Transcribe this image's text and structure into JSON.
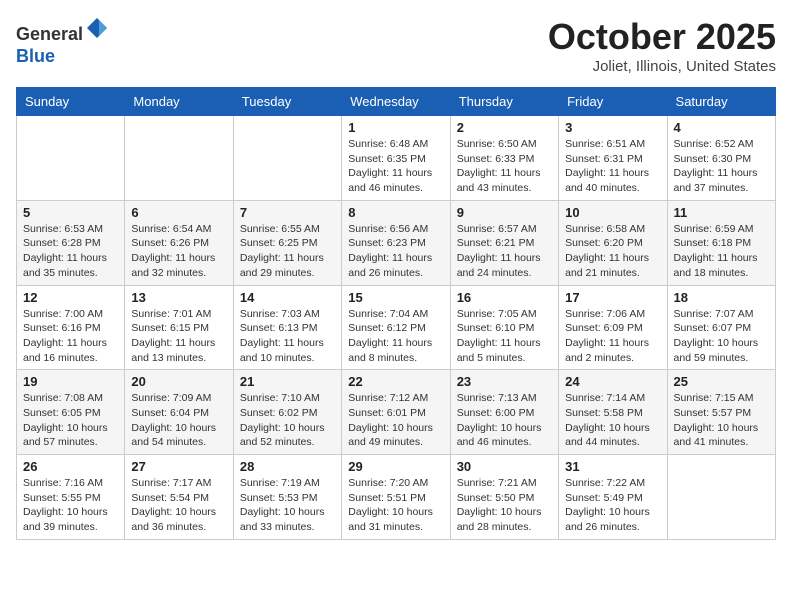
{
  "header": {
    "logo_line1": "General",
    "logo_line2": "Blue",
    "month": "October 2025",
    "location": "Joliet, Illinois, United States"
  },
  "days_of_week": [
    "Sunday",
    "Monday",
    "Tuesday",
    "Wednesday",
    "Thursday",
    "Friday",
    "Saturday"
  ],
  "weeks": [
    [
      {
        "day": "",
        "info": ""
      },
      {
        "day": "",
        "info": ""
      },
      {
        "day": "",
        "info": ""
      },
      {
        "day": "1",
        "info": "Sunrise: 6:48 AM\nSunset: 6:35 PM\nDaylight: 11 hours\nand 46 minutes."
      },
      {
        "day": "2",
        "info": "Sunrise: 6:50 AM\nSunset: 6:33 PM\nDaylight: 11 hours\nand 43 minutes."
      },
      {
        "day": "3",
        "info": "Sunrise: 6:51 AM\nSunset: 6:31 PM\nDaylight: 11 hours\nand 40 minutes."
      },
      {
        "day": "4",
        "info": "Sunrise: 6:52 AM\nSunset: 6:30 PM\nDaylight: 11 hours\nand 37 minutes."
      }
    ],
    [
      {
        "day": "5",
        "info": "Sunrise: 6:53 AM\nSunset: 6:28 PM\nDaylight: 11 hours\nand 35 minutes."
      },
      {
        "day": "6",
        "info": "Sunrise: 6:54 AM\nSunset: 6:26 PM\nDaylight: 11 hours\nand 32 minutes."
      },
      {
        "day": "7",
        "info": "Sunrise: 6:55 AM\nSunset: 6:25 PM\nDaylight: 11 hours\nand 29 minutes."
      },
      {
        "day": "8",
        "info": "Sunrise: 6:56 AM\nSunset: 6:23 PM\nDaylight: 11 hours\nand 26 minutes."
      },
      {
        "day": "9",
        "info": "Sunrise: 6:57 AM\nSunset: 6:21 PM\nDaylight: 11 hours\nand 24 minutes."
      },
      {
        "day": "10",
        "info": "Sunrise: 6:58 AM\nSunset: 6:20 PM\nDaylight: 11 hours\nand 21 minutes."
      },
      {
        "day": "11",
        "info": "Sunrise: 6:59 AM\nSunset: 6:18 PM\nDaylight: 11 hours\nand 18 minutes."
      }
    ],
    [
      {
        "day": "12",
        "info": "Sunrise: 7:00 AM\nSunset: 6:16 PM\nDaylight: 11 hours\nand 16 minutes."
      },
      {
        "day": "13",
        "info": "Sunrise: 7:01 AM\nSunset: 6:15 PM\nDaylight: 11 hours\nand 13 minutes."
      },
      {
        "day": "14",
        "info": "Sunrise: 7:03 AM\nSunset: 6:13 PM\nDaylight: 11 hours\nand 10 minutes."
      },
      {
        "day": "15",
        "info": "Sunrise: 7:04 AM\nSunset: 6:12 PM\nDaylight: 11 hours\nand 8 minutes."
      },
      {
        "day": "16",
        "info": "Sunrise: 7:05 AM\nSunset: 6:10 PM\nDaylight: 11 hours\nand 5 minutes."
      },
      {
        "day": "17",
        "info": "Sunrise: 7:06 AM\nSunset: 6:09 PM\nDaylight: 11 hours\nand 2 minutes."
      },
      {
        "day": "18",
        "info": "Sunrise: 7:07 AM\nSunset: 6:07 PM\nDaylight: 10 hours\nand 59 minutes."
      }
    ],
    [
      {
        "day": "19",
        "info": "Sunrise: 7:08 AM\nSunset: 6:05 PM\nDaylight: 10 hours\nand 57 minutes."
      },
      {
        "day": "20",
        "info": "Sunrise: 7:09 AM\nSunset: 6:04 PM\nDaylight: 10 hours\nand 54 minutes."
      },
      {
        "day": "21",
        "info": "Sunrise: 7:10 AM\nSunset: 6:02 PM\nDaylight: 10 hours\nand 52 minutes."
      },
      {
        "day": "22",
        "info": "Sunrise: 7:12 AM\nSunset: 6:01 PM\nDaylight: 10 hours\nand 49 minutes."
      },
      {
        "day": "23",
        "info": "Sunrise: 7:13 AM\nSunset: 6:00 PM\nDaylight: 10 hours\nand 46 minutes."
      },
      {
        "day": "24",
        "info": "Sunrise: 7:14 AM\nSunset: 5:58 PM\nDaylight: 10 hours\nand 44 minutes."
      },
      {
        "day": "25",
        "info": "Sunrise: 7:15 AM\nSunset: 5:57 PM\nDaylight: 10 hours\nand 41 minutes."
      }
    ],
    [
      {
        "day": "26",
        "info": "Sunrise: 7:16 AM\nSunset: 5:55 PM\nDaylight: 10 hours\nand 39 minutes."
      },
      {
        "day": "27",
        "info": "Sunrise: 7:17 AM\nSunset: 5:54 PM\nDaylight: 10 hours\nand 36 minutes."
      },
      {
        "day": "28",
        "info": "Sunrise: 7:19 AM\nSunset: 5:53 PM\nDaylight: 10 hours\nand 33 minutes."
      },
      {
        "day": "29",
        "info": "Sunrise: 7:20 AM\nSunset: 5:51 PM\nDaylight: 10 hours\nand 31 minutes."
      },
      {
        "day": "30",
        "info": "Sunrise: 7:21 AM\nSunset: 5:50 PM\nDaylight: 10 hours\nand 28 minutes."
      },
      {
        "day": "31",
        "info": "Sunrise: 7:22 AM\nSunset: 5:49 PM\nDaylight: 10 hours\nand 26 minutes."
      },
      {
        "day": "",
        "info": ""
      }
    ]
  ]
}
